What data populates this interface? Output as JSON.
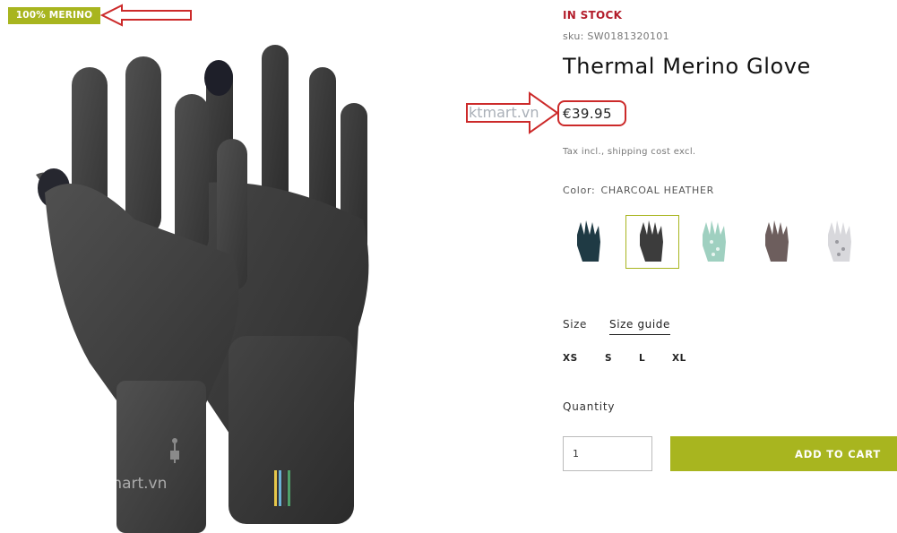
{
  "badge": {
    "label": "100% MERINO"
  },
  "product": {
    "stock": "IN STOCK",
    "sku": "sku: SW0181320101",
    "title": "Thermal Merino Glove",
    "price": "€39.95",
    "tax_note": "Tax incl., shipping cost excl."
  },
  "watermark": {
    "text": "ktmart.vn"
  },
  "color": {
    "label": "Color:",
    "selected": "CHARCOAL HEATHER",
    "swatches": [
      {
        "name": "deep navy",
        "hex": "#1f3a44"
      },
      {
        "name": "charcoal heather",
        "hex": "#3c3c3c"
      },
      {
        "name": "mint pattern",
        "hex": "#9fd0c0"
      },
      {
        "name": "taupe",
        "hex": "#6d5e5d"
      },
      {
        "name": "white pattern",
        "hex": "#d8d8dc"
      }
    ]
  },
  "size": {
    "label": "Size",
    "guide": "Size guide",
    "options": [
      "XS",
      "S",
      "L",
      "XL"
    ]
  },
  "quantity": {
    "label": "Quantity",
    "value": "1"
  },
  "cart": {
    "button_label": "ADD TO CART"
  },
  "colors": {
    "accent": "#a8b51f",
    "stock": "#b31d2b",
    "annotation": "#cc2a2a"
  }
}
